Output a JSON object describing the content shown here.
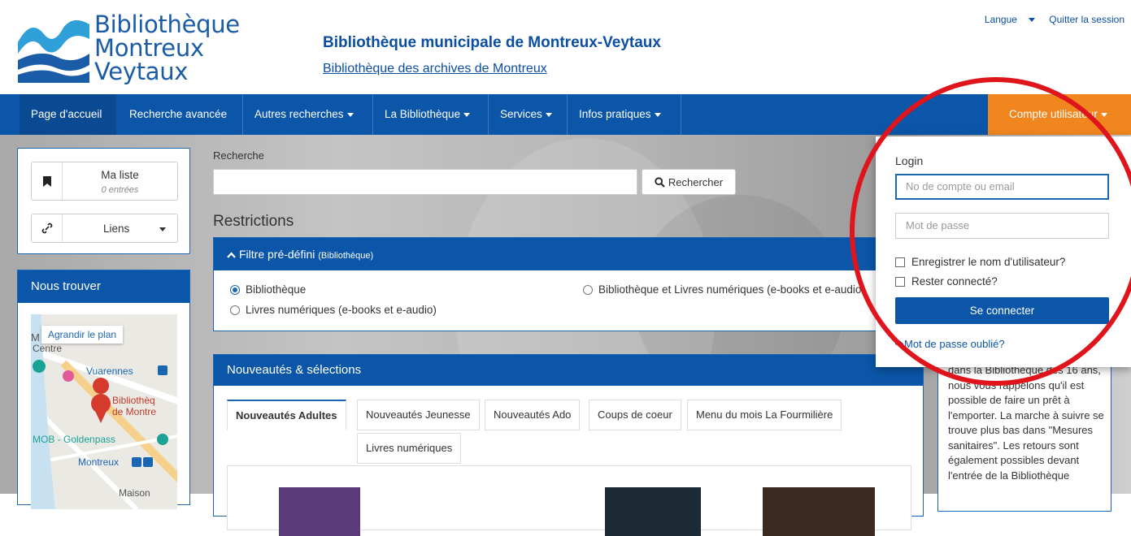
{
  "header": {
    "logo_line1": "Bibliothèque",
    "logo_line2": "Montreux",
    "logo_line3": "Veytaux",
    "title": "Bibliothèque municipale de Montreux-Veytaux",
    "subtitle": "Bibliothèque des archives de Montreux",
    "langue_label": "Langue",
    "logout_label": "Quitter la session"
  },
  "nav": {
    "items": [
      {
        "label": "Page d'accueil"
      },
      {
        "label": "Recherche avancée"
      },
      {
        "label": "Autres recherches"
      },
      {
        "label": "La Bibliothèque"
      },
      {
        "label": "Services"
      },
      {
        "label": "Infos pratiques"
      }
    ],
    "account_label": "Compte utilisateur",
    "accent_color": "#f0861d",
    "primary_color": "#0b56a8"
  },
  "mylist": {
    "title": "Ma liste",
    "count": "0 entrées",
    "links_label": "Liens"
  },
  "find": {
    "title": "Nous trouver",
    "map_button": "Agrandir le plan",
    "map_labels": [
      "M",
      "Centre",
      "Vuarennes",
      "Bibliothèq",
      "de Montre",
      "MOB - Goldenpass",
      "Montreux",
      "Maison"
    ]
  },
  "search": {
    "label": "Recherche",
    "value": "",
    "button": "Rechercher"
  },
  "restrictions": {
    "title": "Restrictions",
    "filter_title": "Filtre pré-défini",
    "filter_sub": "(Bibliothèque)",
    "options": [
      {
        "label": "Bibliothèque",
        "selected": true
      },
      {
        "label": "Bibliothèque et Livres numériques (e-books et e-audio",
        "selected": false
      },
      {
        "label": "Livres numériques (e-books et e-audio)",
        "selected": false
      }
    ]
  },
  "news": {
    "title": "Nouveautés & sélections",
    "tabs": [
      {
        "label": "Nouveautés Adultes",
        "active": true
      },
      {
        "label": "Nouveautés Jeunesse",
        "active": false
      },
      {
        "label": "Nouveautés Ado",
        "active": false
      },
      {
        "label": "Coups de coeur",
        "active": false
      },
      {
        "label": "Menu du mois La Fourmilière",
        "active": false
      },
      {
        "label": "Livres numériques",
        "active": false
      }
    ]
  },
  "right_panel": {
    "text": "dans la Bibliothèque dès 16 ans, nous vous rappelons qu'il est possible de faire un prêt à l'emporter. La marche à suivre se trouve plus bas dans \"Mesures sanitaires\". Les retours sont également possibles devant l'entrée de la Bibliothèque"
  },
  "login": {
    "title": "Login",
    "account_placeholder": "No de compte ou email",
    "password_placeholder": "Mot de passe",
    "remember_label": "Enregistrer le nom d'utilisateur?",
    "stay_label": "Rester connecté?",
    "submit": "Se connecter",
    "forgot": "Mot de passe oublié?"
  },
  "annotation_color": "#e0141b"
}
